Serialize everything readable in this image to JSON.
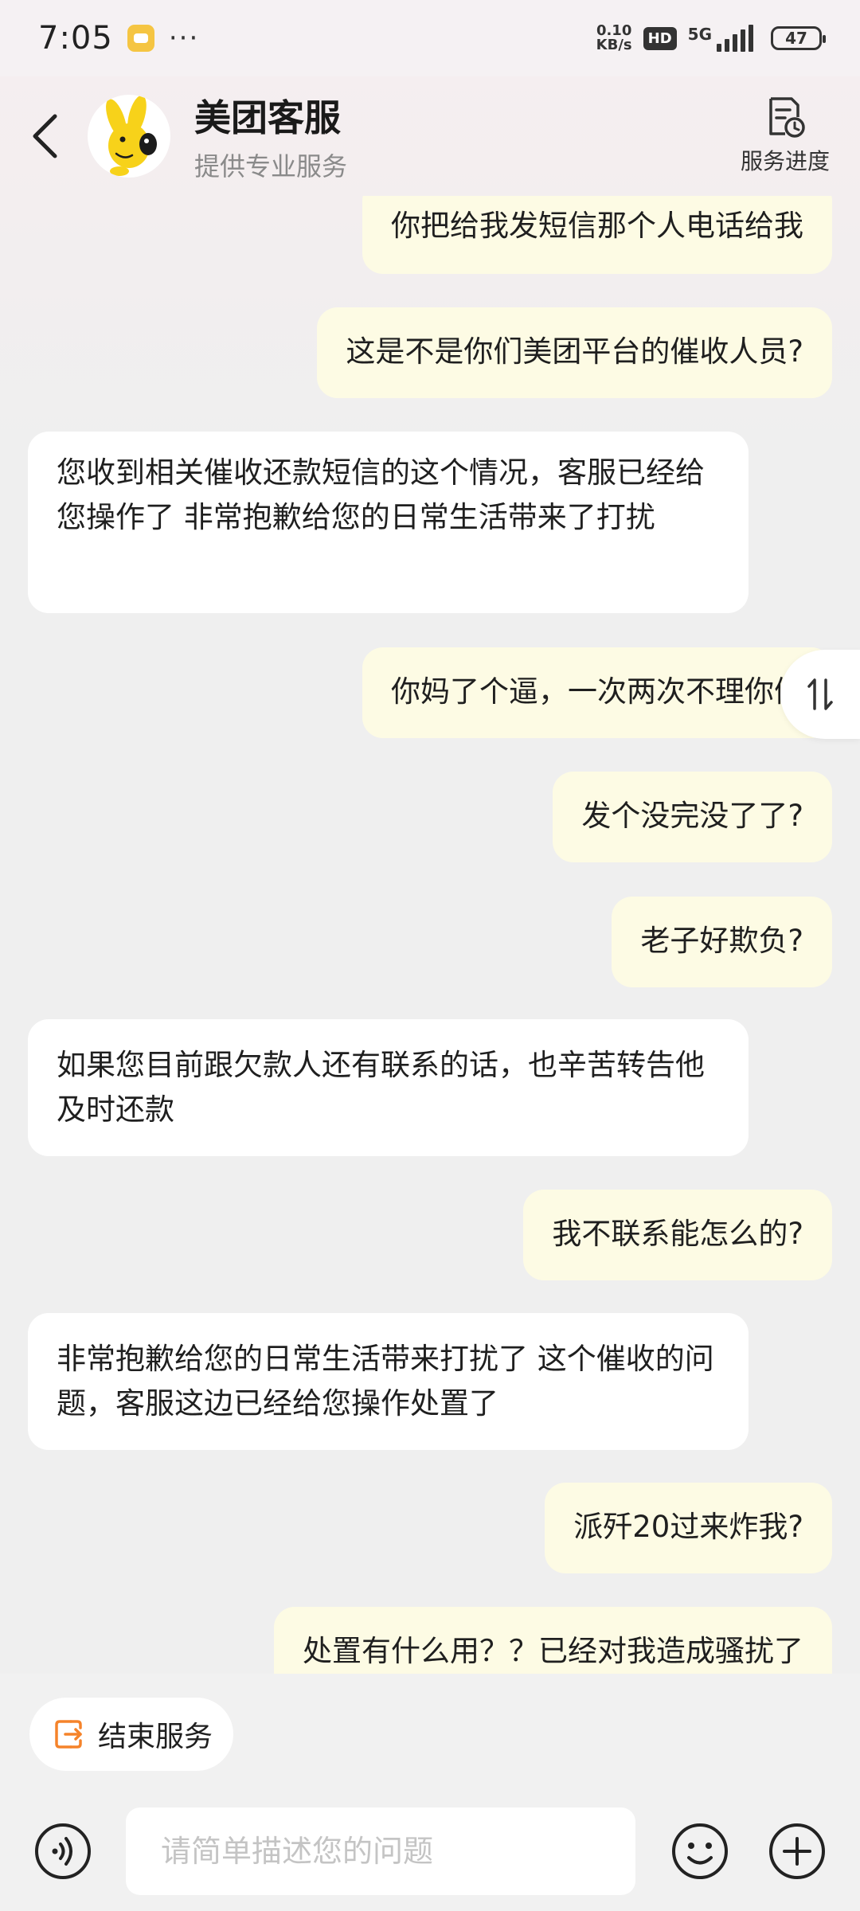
{
  "status_bar": {
    "time": "7:05",
    "more": "···",
    "net_speed_value": "0.10",
    "net_speed_unit": "KB/s",
    "hd": "HD",
    "network": "5G",
    "battery": "47"
  },
  "header": {
    "title": "美团客服",
    "subtitle": "提供专业服务",
    "progress_label": "服务进度"
  },
  "messages": [
    {
      "side": "out",
      "text": "你把给我发短信那个人电话给我"
    },
    {
      "side": "out",
      "text": "这是不是你们美团平台的催收人员?"
    },
    {
      "side": "in",
      "text": "您收到相关催收还款短信的这个情况，客服已经给您操作了 非常抱歉给您的日常生活带来了打扰"
    },
    {
      "side": "out",
      "text": "你妈了个逼，一次两次不理你们"
    },
    {
      "side": "out",
      "text": "发个没完没了了?"
    },
    {
      "side": "out",
      "text": "老子好欺负?"
    },
    {
      "side": "in",
      "text": "如果您目前跟欠款人还有联系的话，也辛苦转告他及时还款"
    },
    {
      "side": "out",
      "text": "我不联系能怎么的?"
    },
    {
      "side": "in",
      "text": "非常抱歉给您的日常生活带来打扰了 这个催收的问题，客服这边已经给您操作处置了"
    },
    {
      "side": "out",
      "text": "派歼20过来炸我?"
    },
    {
      "side": "out",
      "text": "处置有什么用？？已经对我造成骚扰了"
    }
  ],
  "footer": {
    "end_service_label": "结束服务",
    "input_placeholder": "请简单描述您的问题"
  },
  "colors": {
    "outgoing_bubble": "#fdfbe4",
    "incoming_bubble": "#ffffff",
    "end_service_icon": "#f5832a",
    "avatar_yellow": "#f7d21a"
  }
}
